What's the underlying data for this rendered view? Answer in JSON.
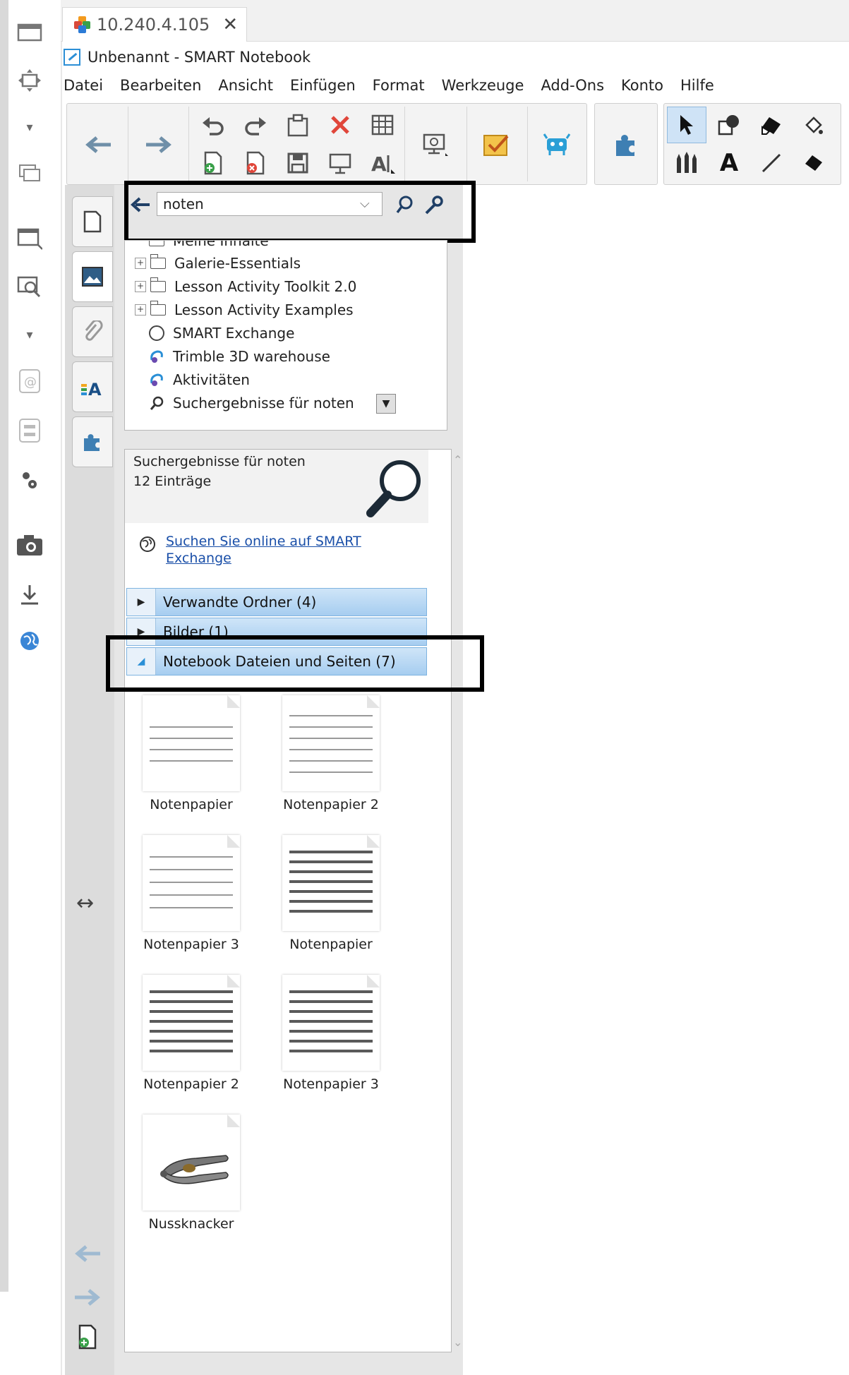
{
  "tab": {
    "title": "10.240.4.105",
    "close": "✕"
  },
  "window": {
    "title": "Unbenannt - SMART Notebook"
  },
  "menu": [
    "Datei",
    "Bearbeiten",
    "Ansicht",
    "Einfügen",
    "Format",
    "Werkzeuge",
    "Add-Ons",
    "Konto",
    "Hilfe"
  ],
  "search": {
    "value": "noten",
    "dropdown_glyph": "⌵"
  },
  "tree": [
    {
      "label": "Meine Inhalte",
      "icon": "folder-icon",
      "expander": ""
    },
    {
      "label": "Galerie-Essentials",
      "icon": "folder-icon",
      "expander": "+"
    },
    {
      "label": "Lesson Activity Toolkit 2.0",
      "icon": "folder-icon",
      "expander": "+"
    },
    {
      "label": "Lesson Activity Examples",
      "icon": "folder-icon",
      "expander": "+"
    },
    {
      "label": "SMART Exchange",
      "icon": "globe-icon",
      "expander": ""
    },
    {
      "label": "Trimble 3D warehouse",
      "icon": "trimble-icon",
      "expander": ""
    },
    {
      "label": "Aktivitäten",
      "icon": "trimble-icon",
      "expander": ""
    },
    {
      "label": "Suchergebnisse für noten",
      "icon": "magnifier-icon",
      "expander": ""
    }
  ],
  "results": {
    "title": "Suchergebnisse für noten",
    "count": "12 Einträge",
    "online_link": "Suchen Sie online auf SMART Exchange",
    "sections": [
      {
        "label": "Verwandte Ordner (4)",
        "expanded": false
      },
      {
        "label": "Bilder (1)",
        "expanded": false
      },
      {
        "label": "Notebook Dateien und Seiten (7)",
        "expanded": true
      }
    ],
    "items": [
      {
        "label": "Notenpapier",
        "kind": "staff-light"
      },
      {
        "label": "Notenpapier 2",
        "kind": "staff-light"
      },
      {
        "label": "Notenpapier 3",
        "kind": "staff-light"
      },
      {
        "label": "Notenpapier",
        "kind": "staff-dark"
      },
      {
        "label": "Notenpapier 2",
        "kind": "staff-dark"
      },
      {
        "label": "Notenpapier 3",
        "kind": "staff-dark"
      },
      {
        "label": "Nussknacker",
        "kind": "nutcracker"
      }
    ]
  },
  "colors": {
    "accent": "#2c8fd6",
    "section_blue": "#a6cdf0",
    "highlight": "#000000",
    "link": "#1a4fa8"
  }
}
